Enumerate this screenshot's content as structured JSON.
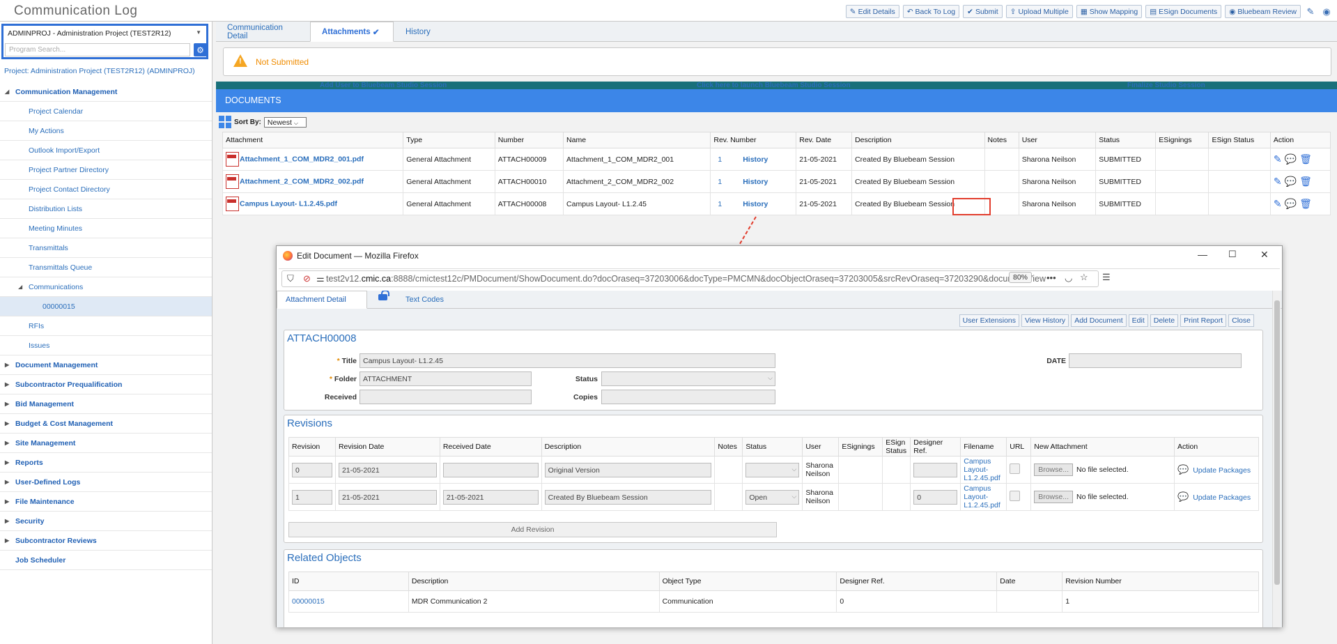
{
  "app": {
    "title": "Communication Log"
  },
  "toolbar": {
    "buttons": [
      "Edit Details",
      "Back To Log",
      "Submit",
      "Upload Multiple",
      "Show Mapping",
      "ESign Documents",
      "Bluebeam Review"
    ],
    "icons": [
      "✎",
      "↶",
      "✔",
      "⇪",
      "▦",
      "▤",
      "◉"
    ]
  },
  "sidebar": {
    "project_select": "ADMINPROJ - Administration Project (TEST2R12)",
    "search_placeholder": "Program Search...",
    "project_title": "Project: Administration Project (TEST2R12) (ADMINPROJ)",
    "items": [
      {
        "label": "Communication Management",
        "level": 0,
        "open": true
      },
      {
        "label": "Project Calendar",
        "level": 1
      },
      {
        "label": "My Actions",
        "level": 1
      },
      {
        "label": "Outlook Import/Export",
        "level": 1
      },
      {
        "label": "Project Partner Directory",
        "level": 1
      },
      {
        "label": "Project Contact Directory",
        "level": 1
      },
      {
        "label": "Distribution Lists",
        "level": 1
      },
      {
        "label": "Meeting Minutes",
        "level": 1
      },
      {
        "label": "Transmittals",
        "level": 1
      },
      {
        "label": "Transmittals Queue",
        "level": 1
      },
      {
        "label": "Communications",
        "level": 1,
        "open": true
      },
      {
        "label": "00000015",
        "level": 2,
        "selected": true
      },
      {
        "label": "RFIs",
        "level": 1
      },
      {
        "label": "Issues",
        "level": 1
      },
      {
        "label": "Document Management",
        "level": 0
      },
      {
        "label": "Subcontractor Prequalification",
        "level": 0
      },
      {
        "label": "Bid Management",
        "level": 0
      },
      {
        "label": "Budget & Cost Management",
        "level": 0
      },
      {
        "label": "Site Management",
        "level": 0
      },
      {
        "label": "Reports",
        "level": 0
      },
      {
        "label": "User-Defined Logs",
        "level": 0
      },
      {
        "label": "File Maintenance",
        "level": 0
      },
      {
        "label": "Security",
        "level": 0
      },
      {
        "label": "Subcontractor Reviews",
        "level": 0
      },
      {
        "label": "Job Scheduler",
        "level": 0,
        "leaf": true
      }
    ]
  },
  "tabs": {
    "detail": "Communication Detail",
    "attachments": "Attachments",
    "history": "History"
  },
  "status_banner": "Not Submitted",
  "bluebeam": {
    "add_user": "Add User to Bluebeam Studio Session",
    "launch": "Click here to launch Bluebeam Studio Session",
    "finalize": "Finalize Studio Session"
  },
  "documents": {
    "header": "DOCUMENTS",
    "sort_label": "Sort By:",
    "sort_value": "Newest",
    "columns": [
      "Attachment",
      "Type",
      "Number",
      "Name",
      "Rev. Number",
      "Rev. Date",
      "Description",
      "Notes",
      "User",
      "Status",
      "ESignings",
      "ESign Status",
      "Action"
    ],
    "rows": [
      {
        "attachment": "Attachment_1_COM_MDR2_001.pdf",
        "type": "General Attachment",
        "number": "ATTACH00009",
        "name": "Attachment_1_COM_MDR2_001",
        "rev": "1",
        "history": "History",
        "date": "21-05-2021",
        "description": "Created By Bluebeam Session",
        "notes": "",
        "user": "Sharona Neilson",
        "status": "SUBMITTED"
      },
      {
        "attachment": "Attachment_2_COM_MDR2_002.pdf",
        "type": "General Attachment",
        "number": "ATTACH00010",
        "name": "Attachment_2_COM_MDR2_002",
        "rev": "1",
        "history": "History",
        "date": "21-05-2021",
        "description": "Created By Bluebeam Session",
        "notes": "",
        "user": "Sharona Neilson",
        "status": "SUBMITTED"
      },
      {
        "attachment": "Campus Layout- L1.2.45.pdf",
        "type": "General Attachment",
        "number": "ATTACH00008",
        "name": "Campus Layout- L1.2.45",
        "rev": "1",
        "history": "History",
        "date": "21-05-2021",
        "description": "Created By Bluebeam Session",
        "notes": "",
        "user": "Sharona Neilson",
        "status": "SUBMITTED"
      }
    ]
  },
  "popup": {
    "window_title": "Edit Document — Mozilla Firefox",
    "url_prefix": "test2v12.",
    "url_domain": "cmic.ca",
    "url_rest": ":8888/cmictest12c/PMDocument/ShowDocument.do?docOraseq=37203006&docType=PMCMN&docObjectOraseq=37203005&srcRevOraseq=37203290&documentView",
    "zoom": "80%",
    "tabs": {
      "detail": "Attachment Detail",
      "text_codes": "Text Codes"
    },
    "buttons": [
      "User Extensions",
      "View History",
      "Add Document",
      "Edit",
      "Delete",
      "Print Report",
      "Close"
    ],
    "doc_number": "ATTACH00008",
    "fields": {
      "title_label": "Title",
      "title_value": "Campus Layout- L1.2.45",
      "folder_label": "Folder",
      "folder_value": "ATTACHMENT",
      "received_label": "Received",
      "received_value": "",
      "status_label": "Status",
      "status_value": "",
      "copies_label": "Copies",
      "copies_value": "",
      "date_label": "DATE",
      "date_value": ""
    },
    "revisions": {
      "title": "Revisions",
      "columns": [
        "Revision",
        "Revision Date",
        "Received Date",
        "Description",
        "Notes",
        "Status",
        "User",
        "ESignings",
        "ESign Status",
        "Designer Ref.",
        "Filename",
        "URL",
        "New Attachment",
        "Action"
      ],
      "rows": [
        {
          "revision": "0",
          "revision_date": "21-05-2021",
          "received_date": "",
          "description": "Original Version",
          "status": "",
          "user": "Sharona Neilson",
          "designer_ref": "",
          "filename": "Campus Layout- L1.2.45.pdf",
          "browse": "Browse...",
          "no_file": "No file selected.",
          "action": "Update Packages"
        },
        {
          "revision": "1",
          "revision_date": "21-05-2021",
          "received_date": "21-05-2021",
          "description": "Created By Bluebeam Session",
          "status": "Open",
          "user": "Sharona Neilson",
          "designer_ref": "0",
          "filename": "Campus Layout- L1.2.45.pdf",
          "browse": "Browse...",
          "no_file": "No file selected.",
          "action": "Update Packages"
        }
      ],
      "add_button": "Add Revision"
    },
    "related": {
      "title": "Related Objects",
      "columns": [
        "ID",
        "Description",
        "Object Type",
        "Designer Ref.",
        "Date",
        "Revision Number"
      ],
      "rows": [
        {
          "id": "00000015",
          "description": "MDR Communication 2",
          "object_type": "Communication",
          "designer_ref": "0",
          "date": "",
          "revision_number": "1"
        }
      ]
    }
  },
  "colors": {
    "accent": "#2f6fd6",
    "banner": "#3c86e8",
    "bluebeam": "#19707a",
    "warning": "#f08c00",
    "callout": "#e23c2c"
  }
}
